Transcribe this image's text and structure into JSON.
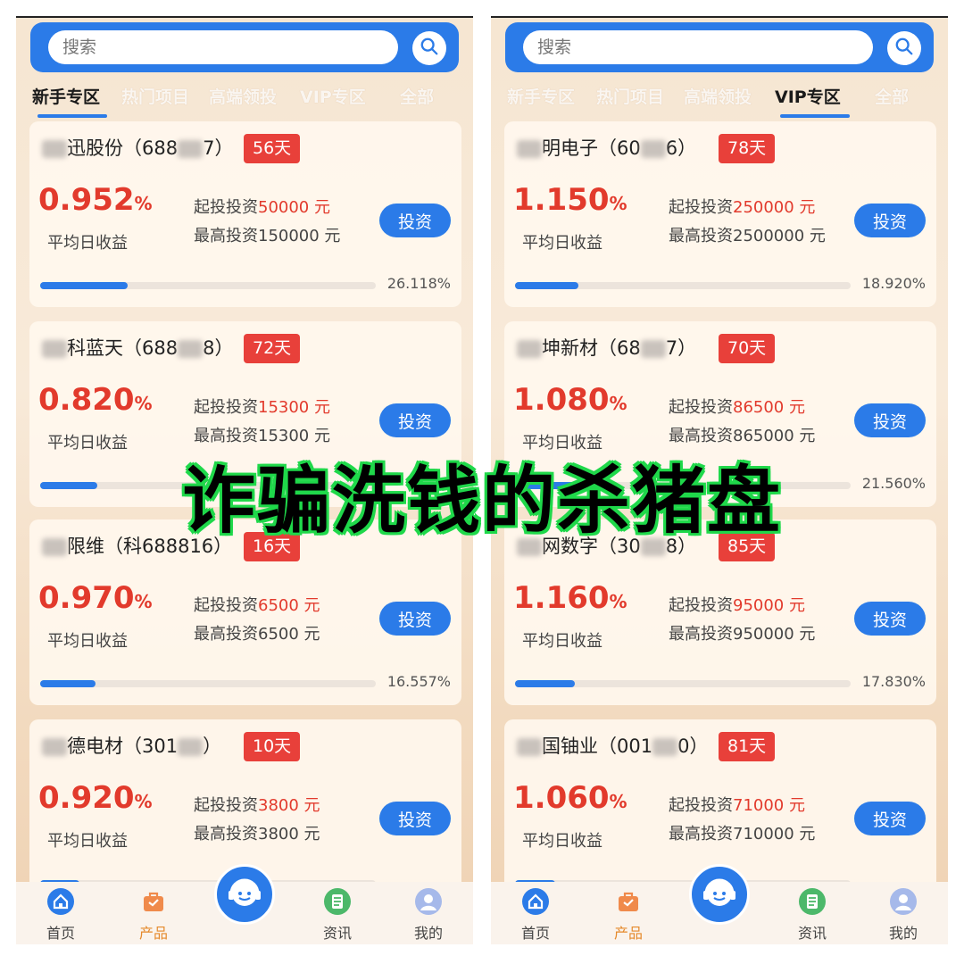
{
  "overlay_title": "诈骗洗钱的杀猪盘",
  "colors": {
    "accent": "#2b7be8",
    "rate_red": "#e23a2c",
    "badge_red": "#e8403a",
    "overlay_stroke": "#1fd84a"
  },
  "search": {
    "placeholder": "搜索"
  },
  "rate_label": "平均日收益",
  "invest_label": "投资",
  "min_prefix": "起投投资",
  "max_prefix": "最高投资",
  "unit": " 元",
  "nav": {
    "home": "首页",
    "products": "产品",
    "news": "资讯",
    "mine": "我的"
  },
  "left": {
    "tabs": [
      "新手专区",
      "热门项目",
      "高端领投",
      "VIP专区",
      "全部"
    ],
    "active_tab": 0,
    "cards": [
      {
        "name_after": "迅股份（688",
        "name_end": "7）",
        "days": "56天",
        "rate": "0.952",
        "min": "50000",
        "max": "150000",
        "progress": "26.118%",
        "progress_value": 0.26
      },
      {
        "name_after": "科蓝天（688",
        "name_end": "8）",
        "days": "72天",
        "rate": "0.820",
        "min": "15300",
        "max": "15300",
        "progress": "",
        "progress_value": 0.17
      },
      {
        "name_after": "限维（科688816）",
        "name_end": "",
        "days": "16天",
        "rate": "0.970",
        "min": "6500",
        "max": "6500",
        "progress": "16.557%",
        "progress_value": 0.166
      },
      {
        "name_after": "德电材（301",
        "name_end": "）",
        "days": "10天",
        "rate": "0.920",
        "min": "3800",
        "max": "3800",
        "progress": "",
        "progress_value": 0.116
      }
    ]
  },
  "right": {
    "tabs": [
      "新手专区",
      "热门项目",
      "高端领投",
      "VIP专区",
      "全部"
    ],
    "active_tab": 3,
    "cards": [
      {
        "name_after": "明电子（60",
        "name_end": "6）",
        "days": "78天",
        "rate": "1.150",
        "min": "250000",
        "max": "2500000",
        "progress": "18.920%",
        "progress_value": 0.189
      },
      {
        "name_after": "坤新材（68",
        "name_end": "7）",
        "days": "70天",
        "rate": "1.080",
        "min": "86500",
        "max": "865000",
        "progress": "21.560%",
        "progress_value": 0.216
      },
      {
        "name_after": "网数字（30",
        "name_end": "8）",
        "days": "85天",
        "rate": "1.160",
        "min": "95000",
        "max": "950000",
        "progress": "17.830%",
        "progress_value": 0.178
      },
      {
        "name_after": "国铀业（001",
        "name_end": "0）",
        "days": "81天",
        "rate": "1.060",
        "min": "71000",
        "max": "710000",
        "progress": "",
        "progress_value": 0.12
      }
    ]
  }
}
